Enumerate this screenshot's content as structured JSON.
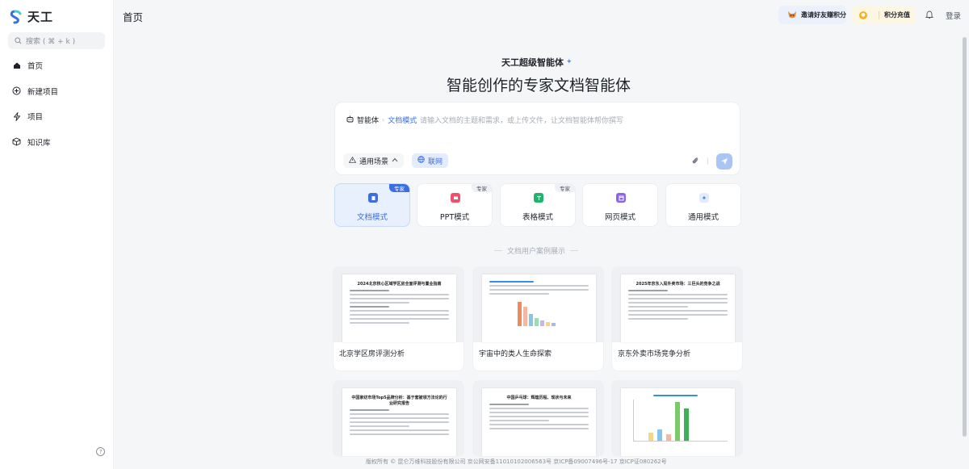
{
  "app": {
    "name": "天工"
  },
  "sidebar": {
    "search_placeholder": "搜索 ( ⌘ + k )",
    "items": [
      {
        "label": "首页",
        "icon": "home-icon",
        "active": true
      },
      {
        "label": "新建项目",
        "icon": "plus-circle-icon"
      },
      {
        "label": "项目",
        "icon": "lightning-icon"
      },
      {
        "label": "知识库",
        "icon": "cube-icon"
      }
    ],
    "help_glyph": "?"
  },
  "header": {
    "title": "首页",
    "invite_label": "邀请好友赚积分",
    "points_label": "积分充值",
    "login_label": "登录"
  },
  "hero": {
    "subtitle": "天工超级智能体",
    "headline": "智能创作的专家文档智能体"
  },
  "input": {
    "agent_label": "智能体",
    "mode_label": "文档模式",
    "placeholder": "请输入文档的主题和需求，或上传文件，让文档智能体帮你撰写",
    "scene_label": "通用场景",
    "net_label": "联网"
  },
  "modes": [
    {
      "label": "文档模式",
      "tag": "专家",
      "active": true,
      "color": "#3a6fe0"
    },
    {
      "label": "PPT模式",
      "tag": "专家",
      "active": false,
      "color": "#f0506e"
    },
    {
      "label": "表格模式",
      "tag": "专家",
      "active": false,
      "color": "#1fb36b"
    },
    {
      "label": "网页模式",
      "tag": "",
      "active": false,
      "color": "#8a63f0"
    },
    {
      "label": "通用模式",
      "tag": "",
      "active": false,
      "color": "#3a8fd8"
    }
  ],
  "cases_title": "文档用户案例展示",
  "cases": [
    {
      "caption": "北京学区房评测分析",
      "doc_title": "2024北京核心区域学区房全面评测与置业指南"
    },
    {
      "caption": "宇宙中的类人生命探索",
      "doc_title": ""
    },
    {
      "caption": "京东外卖市场竞争分析",
      "doc_title": "2025年京东入局外卖市场：三巨头的竞争之战"
    },
    {
      "caption": "",
      "doc_title": "中国家纺市场Top5品牌分析：基于套被领方法论的行业研究报告"
    },
    {
      "caption": "",
      "doc_title": "中国乒乓球：辉煌历程、现状与未来"
    },
    {
      "caption": "",
      "doc_title": ""
    }
  ],
  "footer": "版权所有 © 昆仑万维科技股份有限公司 京公网安备11010102006563号 京ICP备09007496号-17 京ICP证080262号"
}
